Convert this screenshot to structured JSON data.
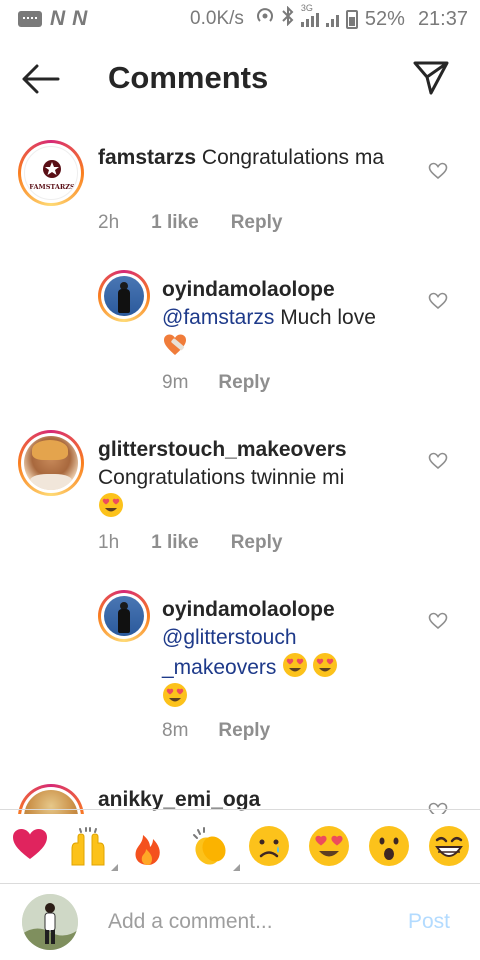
{
  "status_bar": {
    "carrier_icons": [
      "N",
      "N"
    ],
    "speed": "0.0K/s",
    "network": "3G",
    "battery": "52%",
    "time": "21:37"
  },
  "header": {
    "title": "Comments",
    "back_icon": "arrow-left-icon",
    "send_icon": "paper-plane-icon"
  },
  "comments": [
    {
      "username": "famstarzs",
      "text": "Congratulations ma",
      "time": "2h",
      "likes": "1 like",
      "reply": "Reply",
      "avatar_text": "FAMSTARZS"
    },
    {
      "username": "oyindamolaolope",
      "mention": "@famstarzs",
      "text": "Much love",
      "emoji": "heart-with-bandage",
      "time": "9m",
      "reply": "Reply"
    },
    {
      "username": "glitterstouch_makeovers",
      "text": "Congratulations twinnie mi",
      "emoji": "heart-eyes",
      "time": "1h",
      "likes": "1 like",
      "reply": "Reply"
    },
    {
      "username": "oyindamolaolope",
      "mention_line1": "@glitterstouch",
      "mention_line2": "_makeovers",
      "emoji": "heart-eyes",
      "time": "8m",
      "reply": "Reply"
    },
    {
      "username": "anikky_emi_oga"
    }
  ],
  "emoji_bar": [
    "red-heart",
    "raising-hands",
    "fire",
    "clapping-hands",
    "crying-face",
    "heart-eyes",
    "surprised-face",
    "laughing-face"
  ],
  "composer": {
    "placeholder": "Add a comment...",
    "post_label": "Post"
  },
  "colors": {
    "mention": "#1e3a8a",
    "post_disabled": "#b3dbff",
    "meta_gray": "#8e8e8e"
  }
}
